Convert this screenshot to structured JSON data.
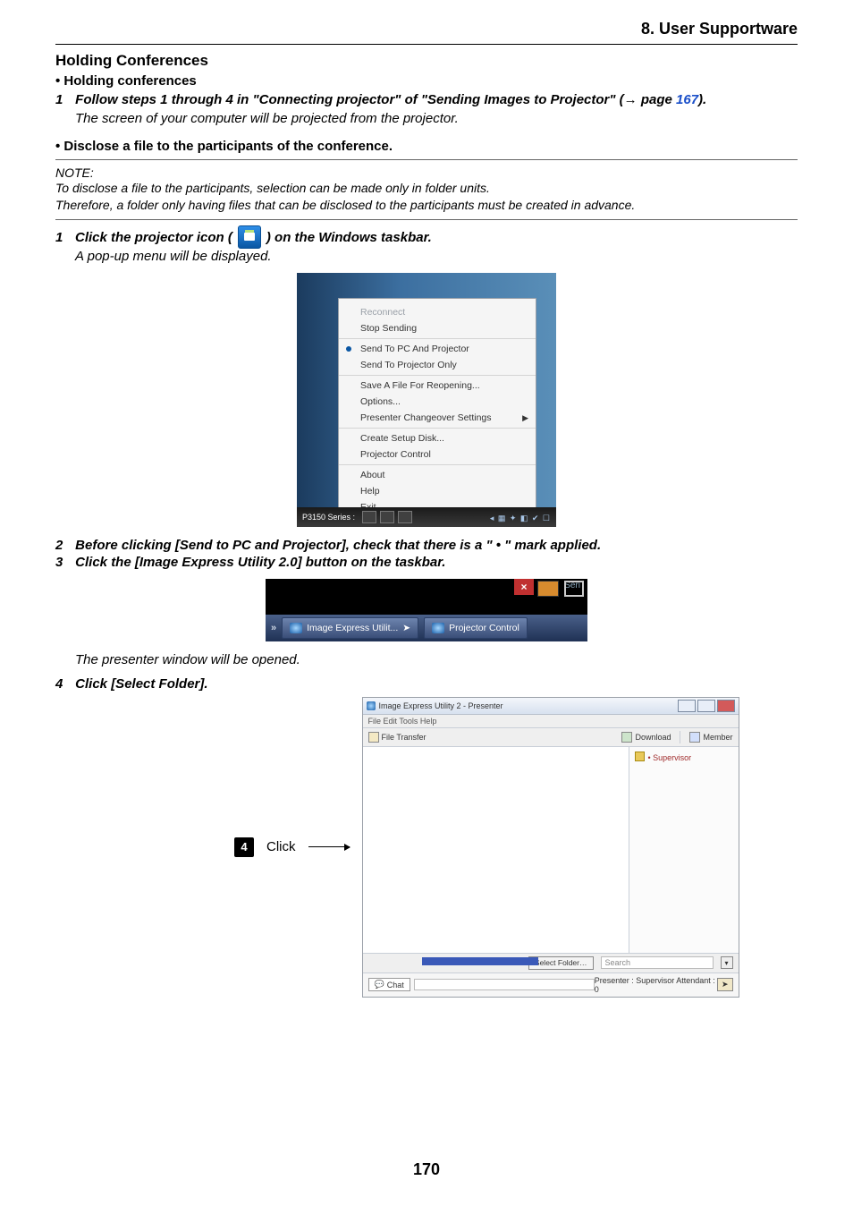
{
  "chapter": "8. User Supportware",
  "title": "Holding Conferences",
  "section1_header": "• Holding conferences",
  "step1": {
    "num": "1",
    "pre": "Follow steps 1 through 4 in \"Connecting projector\" of \"Sending Images to Projector\" (",
    "arrow": "→",
    "page_word": " page ",
    "page_link": "167",
    "post": ")."
  },
  "step1_sub": "The screen of your computer will be projected from the projector.",
  "section2_header": "• Disclose a file to the participants of the conference.",
  "note_label": "NOTE:",
  "note_line1": "To disclose a file to the participants, selection can be made only in folder units.",
  "note_line2": "Therefore, a folder only having files that can be disclosed to the participants must be created in advance.",
  "icon_step": {
    "num": "1",
    "pre": "Click the projector icon (",
    "post": ") on the Windows taskbar."
  },
  "icon_step_sub": "A pop-up menu will be displayed.",
  "context_menu": {
    "reconnect": "Reconnect",
    "stop_sending": "Stop Sending",
    "send_pc_proj": "Send To PC And Projector",
    "send_proj_only": "Send To Projector Only",
    "save_reopen": "Save A File For Reopening...",
    "options": "Options...",
    "changeover": "Presenter Changeover Settings",
    "create_disk": "Create Setup Disk...",
    "proj_control": "Projector Control",
    "about": "About",
    "help": "Help",
    "exit": "Exit",
    "taskbar_label": "P3150 Series :"
  },
  "step2": {
    "num": "2",
    "text": "Before clicking [Send to PC and Projector], check that there is a \" • \" mark applied."
  },
  "step3": {
    "num": "3",
    "text": "Click the [Image Express Utility 2.0] button on the taskbar."
  },
  "taskbar_shot": {
    "ser": "Seri",
    "btn1": "Image Express Utilit...",
    "btn2": "Projector Control"
  },
  "presenter_open_text": "The presenter window will be opened.",
  "step4": {
    "num": "4",
    "text": "Click [Select Folder]."
  },
  "click_badge": {
    "num": "4",
    "label": "Click"
  },
  "pw": {
    "title_icon_text": "Image Express Utility 2 - Presenter",
    "menu": "File   Edit   Tools   Help",
    "file_transfer": "File Transfer",
    "download": "Download",
    "member": "Member",
    "supervisor": "• Supervisor",
    "select_folder": "Select Folder…",
    "search": "Search",
    "chat": "Chat",
    "status_mid": "Presenter : Supervisor   Attendant : 0"
  },
  "page_number": "170"
}
